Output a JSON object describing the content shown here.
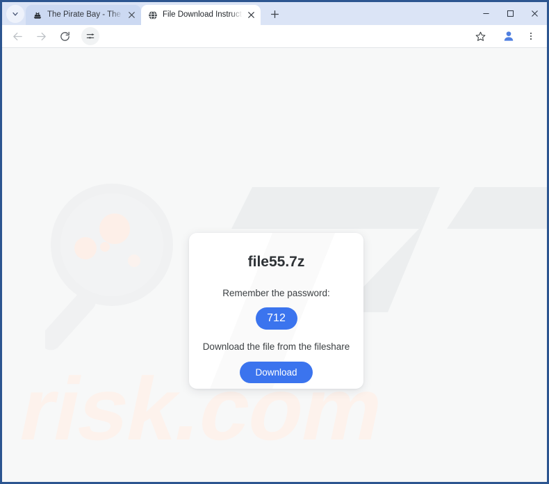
{
  "browser": {
    "tab_search_icon": "chevron-down-icon",
    "new_tab_label": "+",
    "tabs": [
      {
        "title": "The Pirate Bay - The galaxy's m",
        "favicon": "pirate-ship-icon",
        "active": false,
        "close_label": "×"
      },
      {
        "title": "File Download Instructions for f",
        "favicon": "globe-icon",
        "active": true,
        "close_label": "×"
      }
    ],
    "window_controls": {
      "minimize": "–",
      "maximize": "□",
      "close": "✕"
    },
    "toolbar": {
      "back": "back-arrow-icon",
      "forward": "forward-arrow-icon",
      "reload": "reload-icon",
      "tune": "tune-sliders-icon",
      "bookmark": "star-icon",
      "profile": "profile-avatar-icon",
      "menu": "three-dot-menu-icon"
    }
  },
  "page": {
    "background_color": "#f7f8f8",
    "watermark_text": "risk.com",
    "watermark_mark": "Z",
    "card": {
      "title": "file55.7z",
      "password_label": "Remember the password:",
      "password_value": "712",
      "instruction": "Download the file from the fileshare",
      "download_button": "Download",
      "accent_color": "#3b74ee"
    }
  }
}
